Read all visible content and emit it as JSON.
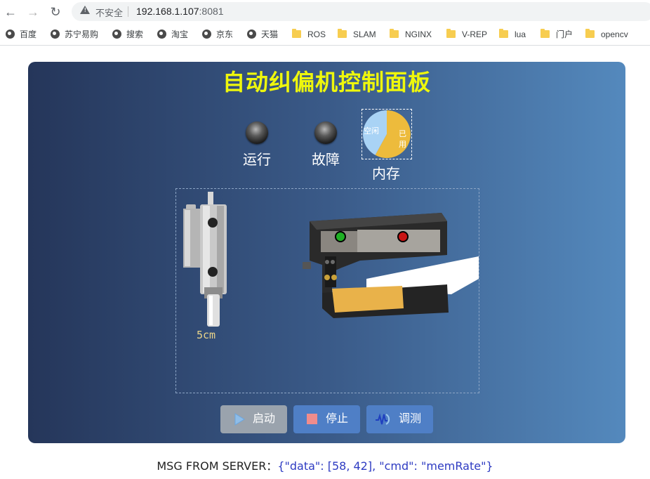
{
  "browser": {
    "back_icon": "arrow-left-icon",
    "forward_icon": "arrow-right-icon",
    "reload_icon": "reload-icon",
    "insecure_label": "不安全",
    "url_host": "192.168.1.107",
    "url_port": ":8081"
  },
  "bookmarks": [
    {
      "label": "百度",
      "icon": "globe-icon"
    },
    {
      "label": "苏宁易购",
      "icon": "globe-icon"
    },
    {
      "label": "搜索",
      "icon": "globe-icon"
    },
    {
      "label": "淘宝",
      "icon": "globe-icon"
    },
    {
      "label": "京东",
      "icon": "globe-icon"
    },
    {
      "label": "天猫",
      "icon": "globe-icon"
    },
    {
      "label": "ROS",
      "icon": "folder-icon"
    },
    {
      "label": "SLAM",
      "icon": "folder-icon"
    },
    {
      "label": "NGINX",
      "icon": "folder-icon"
    },
    {
      "label": "V-REP",
      "icon": "folder-icon"
    },
    {
      "label": "lua",
      "icon": "folder-icon"
    },
    {
      "label": "门户",
      "icon": "folder-icon"
    },
    {
      "label": "opencv",
      "icon": "folder-icon"
    }
  ],
  "panel": {
    "title": "自动纠偏机控制面板",
    "title_color": "#eef70c",
    "indicators": {
      "run_label": "运行",
      "fault_label": "故障"
    },
    "memory": {
      "label": "内存",
      "free_label": "空闲",
      "used_label": "已用",
      "free_value": 42,
      "used_value": 58,
      "free_color": "#a9d3f5",
      "used_color": "#edbb3c"
    },
    "actuator_distance": "5cm",
    "buttons": {
      "start": "启动",
      "stop": "停止",
      "tune": "调测"
    }
  },
  "server_message": {
    "prefix": "MSG FROM SERVER：",
    "payload": "{\"data\": [58, 42], \"cmd\": \"memRate\"}"
  }
}
